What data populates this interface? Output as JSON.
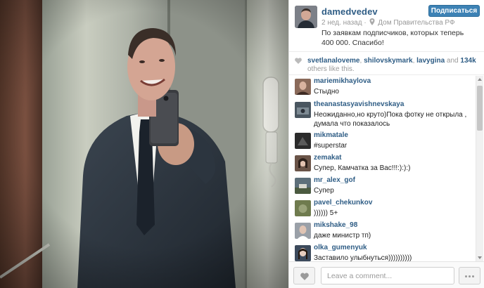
{
  "post": {
    "username": "damedvedev",
    "time_ago": "2 нед. назад",
    "location": "Дом Правительства РФ",
    "follow_label": "Подписаться",
    "caption": "По заявкам подписчиков, которых теперь 400 000. Спасибо!"
  },
  "likes": {
    "users": [
      "svetlanaloveme",
      "shilovskymark",
      "lavygina"
    ],
    "sep1": ", ",
    "sep2": ", ",
    "and_text": " and ",
    "count": "134k",
    "suffix": " others like this."
  },
  "comments": [
    {
      "user": "mariemikhaylova",
      "text": "Стыдно",
      "avatar_color": "#8a6a5a"
    },
    {
      "user": "theanastasyavishnevskaya",
      "text": "Неожиданно,но круто)Пока фотку не открыла , думала что показалось",
      "avatar_color": "#4a5660"
    },
    {
      "user": "mikmatale",
      "text": "#superstar",
      "avatar_color": "#2b2b2b"
    },
    {
      "user": "zemakat",
      "text": "Супер, Камчатка за Вас!!!:):):)",
      "avatar_color": "#6a5448"
    },
    {
      "user": "mr_alex_gof",
      "text": "Супер",
      "avatar_color": "#5d6f7a"
    },
    {
      "user": "pavel_chekunkov",
      "text": ")))))) 5+",
      "avatar_color": "#6f7b4e"
    },
    {
      "user": "mikshake_98",
      "text": "даже министр тп)",
      "avatar_color": "#9aa0a8"
    },
    {
      "user": "olka_gumenyuk",
      "text": "Заставило улыбнуться))))))))))",
      "avatar_color": "#3c4a5c"
    }
  ],
  "compose": {
    "placeholder": "Leave a comment..."
  },
  "icons": {
    "heart": "heart-icon",
    "pin": "location-pin-icon",
    "more": "more-dots-icon"
  },
  "colors": {
    "username_blue": "#2f5d85",
    "follow_button": "#3d82b5"
  }
}
